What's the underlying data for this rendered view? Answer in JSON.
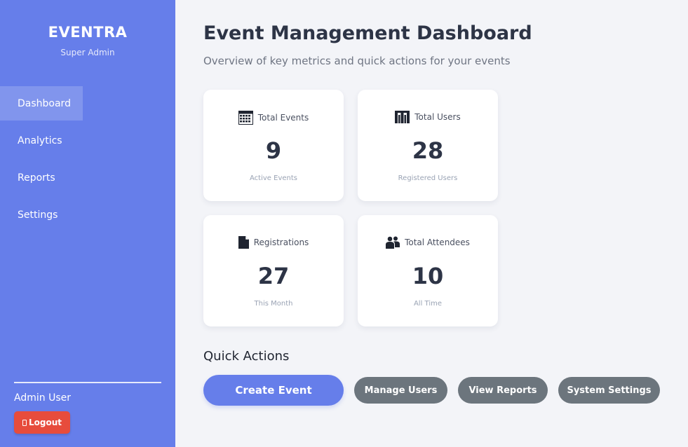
{
  "sidebar": {
    "brand": "EVENTRA",
    "role": "Super Admin",
    "nav": [
      {
        "label": "Dashboard",
        "active": true
      },
      {
        "label": "Analytics"
      },
      {
        "label": "Reports"
      },
      {
        "label": "Settings"
      }
    ],
    "user_name": "Admin User",
    "logout_label": "Logout"
  },
  "main": {
    "title": "Event Management Dashboard",
    "subtitle": "Overview of key metrics and quick actions for your events",
    "stats": [
      {
        "label": "Total Events",
        "value": "9",
        "sub": "Active Events",
        "icon": "calendar-icon"
      },
      {
        "label": "Total Users",
        "value": "28",
        "sub": "Registered Users",
        "icon": "users-bars-icon"
      },
      {
        "label": "Registrations",
        "value": "27",
        "sub": "This Month",
        "icon": "document-icon"
      },
      {
        "label": "Total Attendees",
        "value": "10",
        "sub": "All Time",
        "icon": "people-icon"
      }
    ],
    "quick_actions_title": "Quick Actions",
    "actions": {
      "create": "Create Event",
      "manage_users": "Manage Users",
      "view_reports": "View Reports",
      "system_settings": "System Settings"
    }
  },
  "colors": {
    "sidebar": "#667eea",
    "background": "#f3f4f8",
    "primary": "#667eea",
    "secondary": "#6c757d",
    "danger": "#e74c3c"
  }
}
